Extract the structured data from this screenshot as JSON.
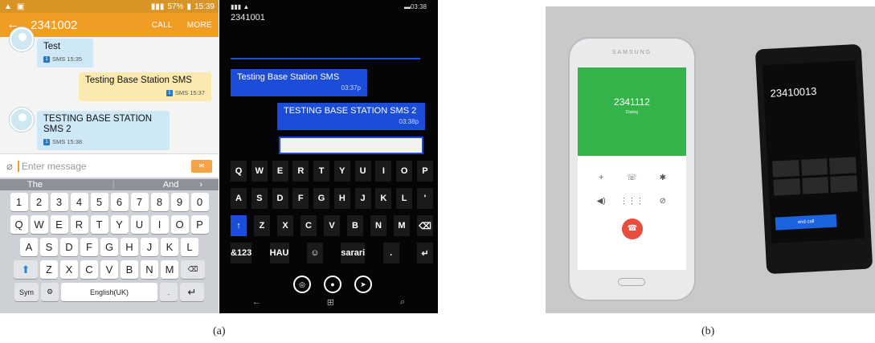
{
  "android": {
    "status": {
      "time": "15:39",
      "battery": "57%"
    },
    "appbar": {
      "title": "2341002",
      "call": "CALL",
      "more": "MORE"
    },
    "messages": [
      {
        "text": "Test",
        "meta": "SMS 15:35",
        "dir": "in"
      },
      {
        "text": "Testing Base Station SMS",
        "meta": "SMS 15:37",
        "dir": "out"
      },
      {
        "text": "TESTING BASE STATION SMS 2",
        "meta": "SMS 15:38",
        "dir": "in"
      }
    ],
    "input": {
      "placeholder": "Enter message"
    },
    "suggestions": [
      "The",
      "|",
      "And"
    ],
    "keyboard": {
      "row1": [
        "1",
        "2",
        "3",
        "4",
        "5",
        "6",
        "7",
        "8",
        "9",
        "0"
      ],
      "row2": [
        "Q",
        "W",
        "E",
        "R",
        "T",
        "Y",
        "U",
        "I",
        "O",
        "P"
      ],
      "row3": [
        "A",
        "S",
        "D",
        "F",
        "G",
        "H",
        "J",
        "K",
        "L"
      ],
      "row4": [
        "Z",
        "X",
        "C",
        "V",
        "B",
        "N",
        "M"
      ],
      "sym": "Sym",
      "space": "English(UK)"
    }
  },
  "winphone": {
    "status": {
      "time": "03:38"
    },
    "title": "2341001",
    "messages": [
      {
        "text": "Testing Base Station SMS",
        "time": "03:37p"
      },
      {
        "text": "TESTING BASE STATION SMS 2",
        "time": "03:38p"
      }
    ],
    "keyboard": {
      "row1": [
        "Q",
        "W",
        "E",
        "R",
        "T",
        "Y",
        "U",
        "I",
        "O",
        "P"
      ],
      "row2": [
        "A",
        "S",
        "D",
        "F",
        "G",
        "H",
        "J",
        "K",
        "L",
        "'"
      ],
      "row3": [
        "↑",
        "Z",
        "X",
        "C",
        "V",
        "B",
        "N",
        "M",
        "⌫"
      ],
      "row4": [
        "&123",
        "HAU",
        "☺",
        "sarari",
        ".",
        "↵"
      ]
    }
  },
  "photo": {
    "phone1": {
      "brand": "SAMSUNG",
      "number": "2341112",
      "sub": "Dialing"
    },
    "phone2": {
      "number": "23410013",
      "end": "end call"
    }
  },
  "captions": {
    "a": "(a)",
    "b": "(b)"
  }
}
